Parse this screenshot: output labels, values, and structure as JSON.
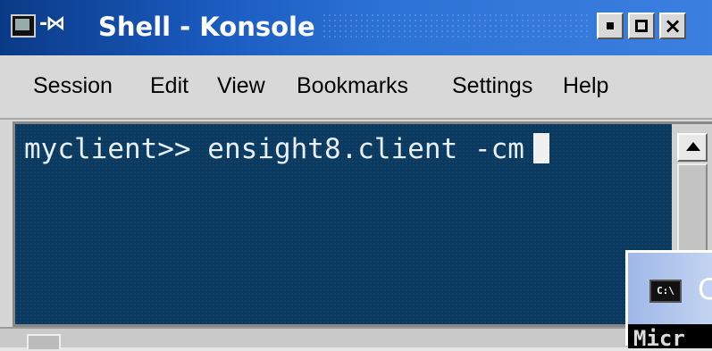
{
  "window": {
    "title": "Shell - Konsole",
    "icon": "terminal-icon",
    "title_glyph": "-⋈",
    "controls": {
      "minimize": "minimize-icon",
      "maximize": "maximize-icon",
      "close": "×"
    }
  },
  "menu": [
    "Session",
    "Edit",
    "View",
    "Bookmarks",
    "Settings",
    "Help"
  ],
  "terminal": {
    "prompt_line": "myclient>> ensight8.client -cm",
    "background": "#0b3a5e",
    "foreground": "#e8eef5"
  },
  "cmd_window": {
    "icon_text": "C:\\",
    "title_partial": "C",
    "body_partial": "Micr"
  },
  "colors": {
    "titlebar_accent": "#2d73d5"
  }
}
